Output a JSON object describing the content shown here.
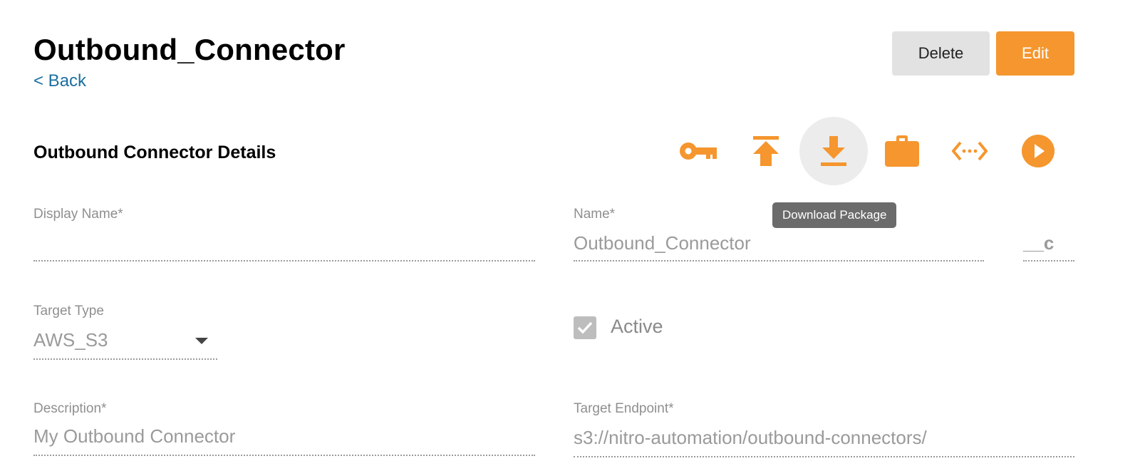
{
  "header": {
    "title": "Outbound_Connector",
    "back_label": "< Back",
    "delete_label": "Delete",
    "edit_label": "Edit"
  },
  "section": {
    "title": "Outbound Connector Details"
  },
  "toolbar": {
    "icons": [
      "key-icon",
      "upload-icon",
      "download-icon",
      "briefcase-icon",
      "code-icon",
      "play-icon"
    ],
    "accent_color": "#f5962e",
    "tooltip": "Download Package"
  },
  "form": {
    "display_name": {
      "label": "Display Name*",
      "value": ""
    },
    "name": {
      "label": "Name*",
      "value": "Outbound_Connector",
      "suffix": "__c"
    },
    "target_type": {
      "label": "Target Type",
      "value": "AWS_S3"
    },
    "active": {
      "label": "Active",
      "checked": true
    },
    "description": {
      "label": "Description*",
      "value": "My Outbound Connector"
    },
    "target_endpoint": {
      "label": "Target Endpoint*",
      "value": "s3://nitro-automation/outbound-connectors/"
    }
  }
}
